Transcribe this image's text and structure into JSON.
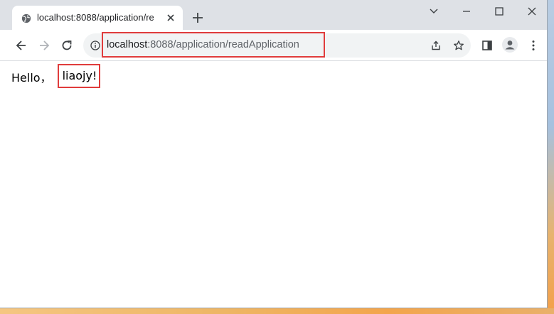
{
  "browser": {
    "tab": {
      "title": "localhost:8088/application/re",
      "favicon": "globe-icon"
    },
    "address_bar": {
      "host": "localhost",
      "path": ":8088/application/readApplication",
      "highlight_color": "#e03c3c"
    },
    "icons": {
      "back": "arrow-left-icon",
      "forward": "arrow-right-icon",
      "reload": "reload-icon",
      "info": "info-icon",
      "share": "share-icon",
      "bookmark": "star-icon",
      "side_panel": "side-panel-icon",
      "profile": "profile-avatar-icon",
      "menu": "kebab-menu-icon"
    }
  },
  "page": {
    "greeting_prefix": "Hello，",
    "greeting_name": "liaojy!"
  }
}
